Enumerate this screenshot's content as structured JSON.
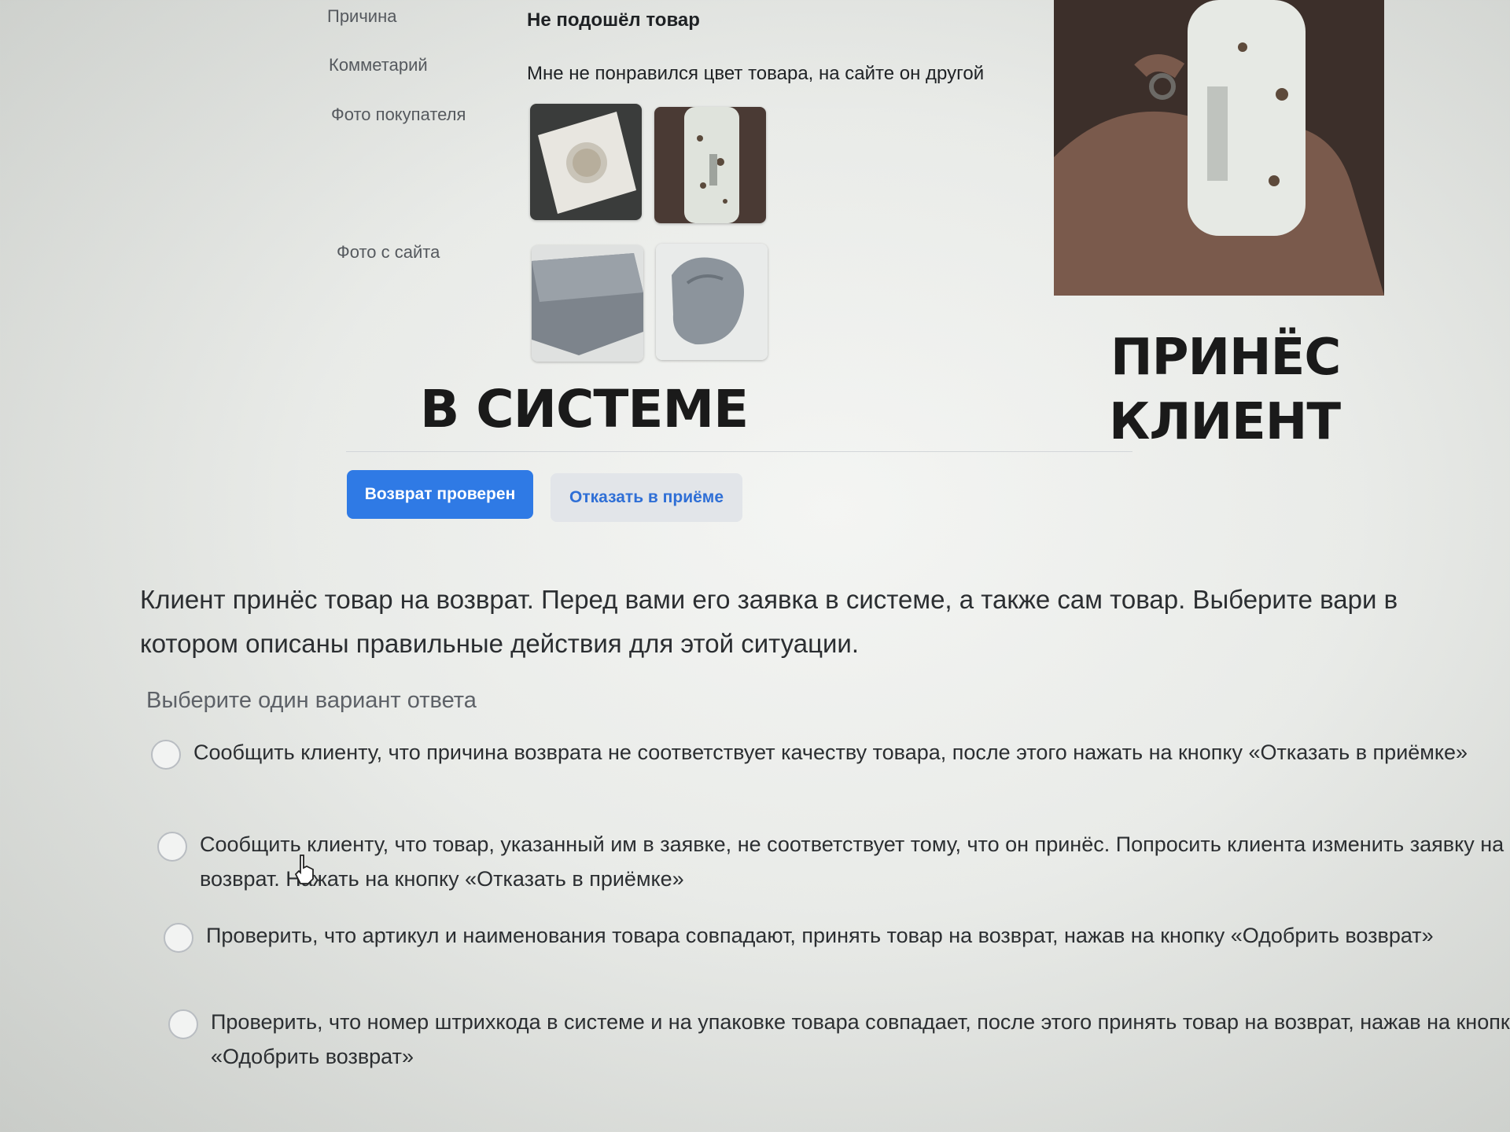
{
  "details": {
    "reason_label": "Причина",
    "reason_value": "Не подошёл товар",
    "comment_label": "Комметарий",
    "comment_value": "Мне не понравился цвет товара, на сайте он другой",
    "customer_photos_label": "Фото покупателя",
    "site_photos_label": "Фото с сайта"
  },
  "overlay_captions": {
    "system": "В СИСТЕМЕ",
    "client_line1": "ПРИНЁС",
    "client_line2": "КЛИЕНТ"
  },
  "actions": {
    "approve_label": "Возврат проверен",
    "reject_label": "Отказать в приёме"
  },
  "quiz": {
    "question": "Клиент принёс товар на возврат. Перед вами его заявка в системе, а также сам товар. Выберите вари в котором описаны правильные действия для этой ситуации.",
    "hint": "Выберите один вариант ответа",
    "options": [
      {
        "text": "Сообщить клиенту, что причина возврата не соответствует качеству товара, после этого нажать на кнопку «Отказать в приёмке»"
      },
      {
        "text": "Сообщить клиенту, что товар, указанный им в заявке, не соответствует тому, что он принёс. Попросить клиента изменить заявку на возврат. Нажать на кнопку «Отказать в приёмке»"
      },
      {
        "text": "Проверить, что артикул и наименования товара совпадают, принять товар на возврат, нажав на кнопку «Одобрить возврат»"
      },
      {
        "text": "Проверить, что номер штрихкода в системе и на упаковке товара совпадает, после этого принять товар на возврат, нажав на кнопку «Одобрить возврат»"
      }
    ]
  },
  "colors": {
    "primary_button": "#2f7ae5",
    "secondary_button_bg": "#e2e5e9",
    "secondary_button_text": "#2f6fd6"
  }
}
